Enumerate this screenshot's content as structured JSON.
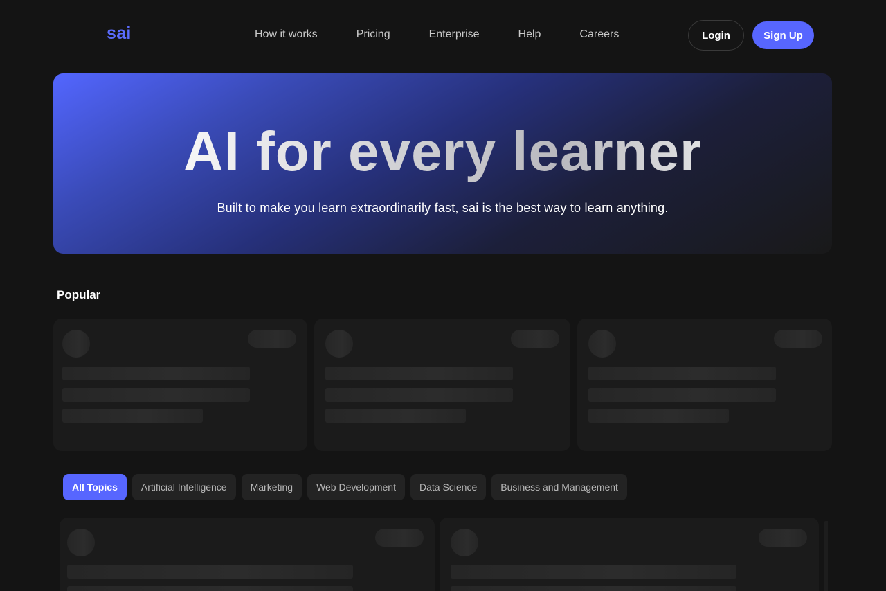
{
  "nav": {
    "logo": "sai",
    "links": [
      "How it works",
      "Pricing",
      "Enterprise",
      "Help",
      "Careers"
    ],
    "login_label": "Login",
    "signup_label": "Sign Up"
  },
  "hero": {
    "title": "AI for every learner",
    "subtitle": "Built to make you learn extraordinarily fast, sai is the best way to learn anything."
  },
  "popular": {
    "title": "Popular"
  },
  "topics": {
    "items": [
      "All Topics",
      "Artificial Intelligence",
      "Marketing",
      "Web Development",
      "Data Science",
      "Business and Management"
    ],
    "selected": "All Topics"
  },
  "colors": {
    "accent": "#5766ff",
    "background": "#141414",
    "card": "#1b1b1b",
    "skeleton": "#262626"
  }
}
